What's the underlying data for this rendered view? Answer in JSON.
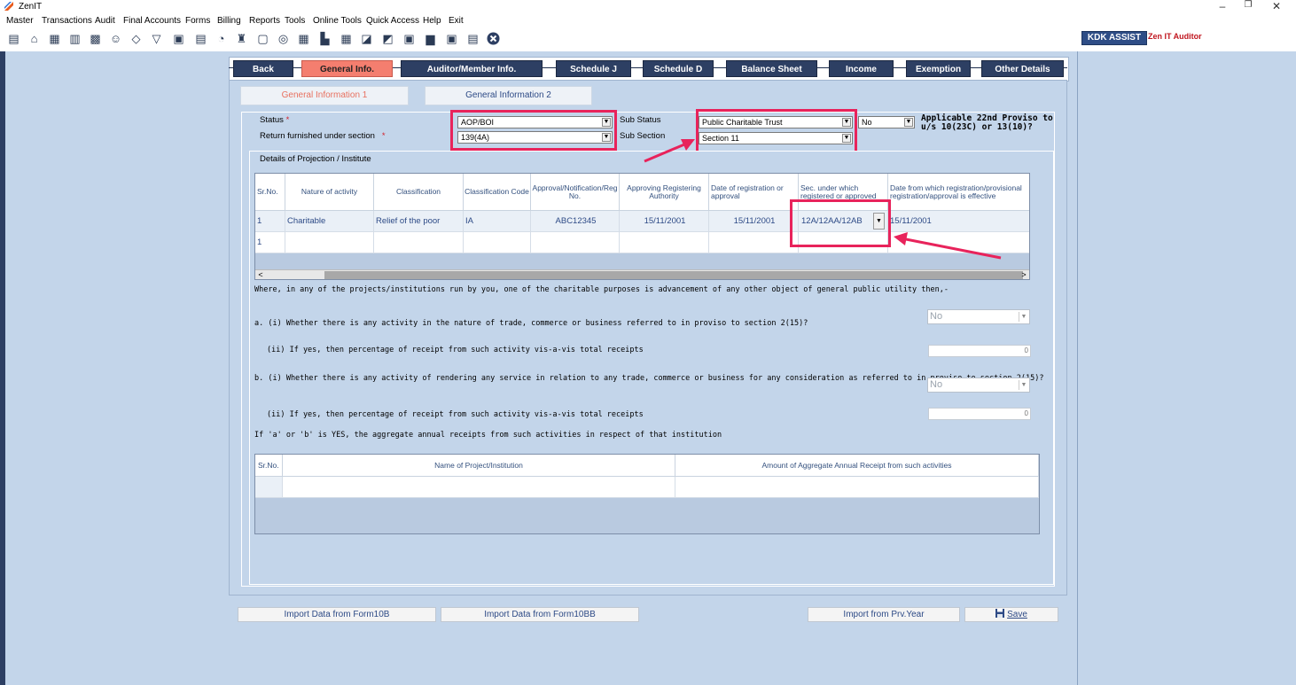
{
  "window": {
    "title": "ZenIT",
    "minimize": "–",
    "restore": "❐",
    "close": "✕"
  },
  "menu": [
    "Master",
    "Transactions",
    "Audit",
    "Final Accounts",
    "Forms",
    "Billing",
    "Reports",
    "Tools",
    "Online Tools",
    "Quick Access",
    "Help",
    "Exit"
  ],
  "branding": {
    "kdk": "KDK ASSIST",
    "product": "Zen IT Auditor"
  },
  "toolbar_icons": [
    "report-icon",
    "home-icon",
    "grid-icon",
    "bar-chart-icon",
    "building-icon",
    "users-icon",
    "tag-icon",
    "filter-icon",
    "tax-icon",
    "calculator-icon",
    "pie-icon",
    "pay-icon",
    "document-icon",
    "zoom-icon",
    "sheet-icon",
    "chart-doc-icon",
    "calendar-icon",
    "transfer-icon",
    "refresh-icon",
    "bs-icon",
    "archive-icon",
    "tds-icon",
    "notes-icon",
    "close-circle-icon"
  ],
  "tabs": [
    "Back",
    "General Info.",
    "Auditor/Member Info.",
    "Schedule J",
    "Schedule D",
    "Balance Sheet",
    "Income",
    "Exemption",
    "Other Details"
  ],
  "active_tab": "General Info.",
  "subtabs": [
    "General Information 1",
    "General Information 2"
  ],
  "form": {
    "status_label": "Status",
    "status_value": "AOP/BOI",
    "return_label": "Return furnished under section",
    "return_value": "139(4A)",
    "required_mark": "*",
    "sub_status_label": "Sub Status",
    "sub_status_value": "Public Charitable Trust",
    "sub_section_label": "Sub Section",
    "sub_section_value": "Section 11",
    "proviso_value": "No",
    "proviso_label_1": "Applicable 22nd Proviso to",
    "proviso_label_2": "u/s 10(23C) or 13(10)?"
  },
  "projection": {
    "title": "Details of Projection / Institute",
    "columns": [
      "Sr.No.",
      "Nature of activity",
      "Classification",
      "Classification Code",
      "Approval/Notification/Reg No.",
      "Approving Registering Authority",
      "Date of registration or approval",
      "Sec. under which registered or approved",
      "Date from which registration/provisional registration/approval is effective"
    ],
    "rows": [
      [
        "1",
        "Charitable",
        "Relief of the poor",
        "IA",
        "ABC12345",
        "15/11/2001",
        "15/11/2001",
        "12A/12AA/12AB",
        "15/11/2001"
      ],
      [
        "1",
        "",
        "",
        "",
        "",
        "",
        "",
        "",
        ""
      ]
    ],
    "scroll_left": "<",
    "scroll_right": ">"
  },
  "questions": {
    "intro": "Where, in any of the projects/institutions run by you, one of the charitable purposes is advancement of any other object of general public utility then,-",
    "a1": "a. (i) Whether there is any activity in the nature of trade, commerce or business referred to in proviso to section 2(15)?",
    "a1_value": "No",
    "a2": "(ii) If yes, then percentage of receipt from such activity vis-a-vis total receipts",
    "a2_value": "0",
    "b1": "b. (i) Whether there is any activity of rendering any service in relation to any trade, commerce or business for any consideration as referred to in proviso to section 2(15)?",
    "b1_value": "No",
    "b2": "(ii) If yes, then percentage of receipt from such activity vis-a-vis total receipts",
    "b2_value": "0",
    "aggregate": "If 'a' or 'b' is YES, the aggregate annual receipts from such activities in respect of that institution"
  },
  "aggregate_table": {
    "columns": [
      "Sr.No.",
      "Name of Project/Institution",
      "Amount of Aggregate Annual Receipt from such activities"
    ]
  },
  "buttons": {
    "import_10b": "Import Data from Form10B",
    "import_10bb": "Import Data from Form10BB",
    "import_prev": "Import from Prv.Year",
    "save": "Save"
  },
  "colors": {
    "tab_bg": "#2d3f63",
    "active_tab": "#f47e6f",
    "highlight": "#e8235b",
    "panel": "#c3d5ea"
  }
}
